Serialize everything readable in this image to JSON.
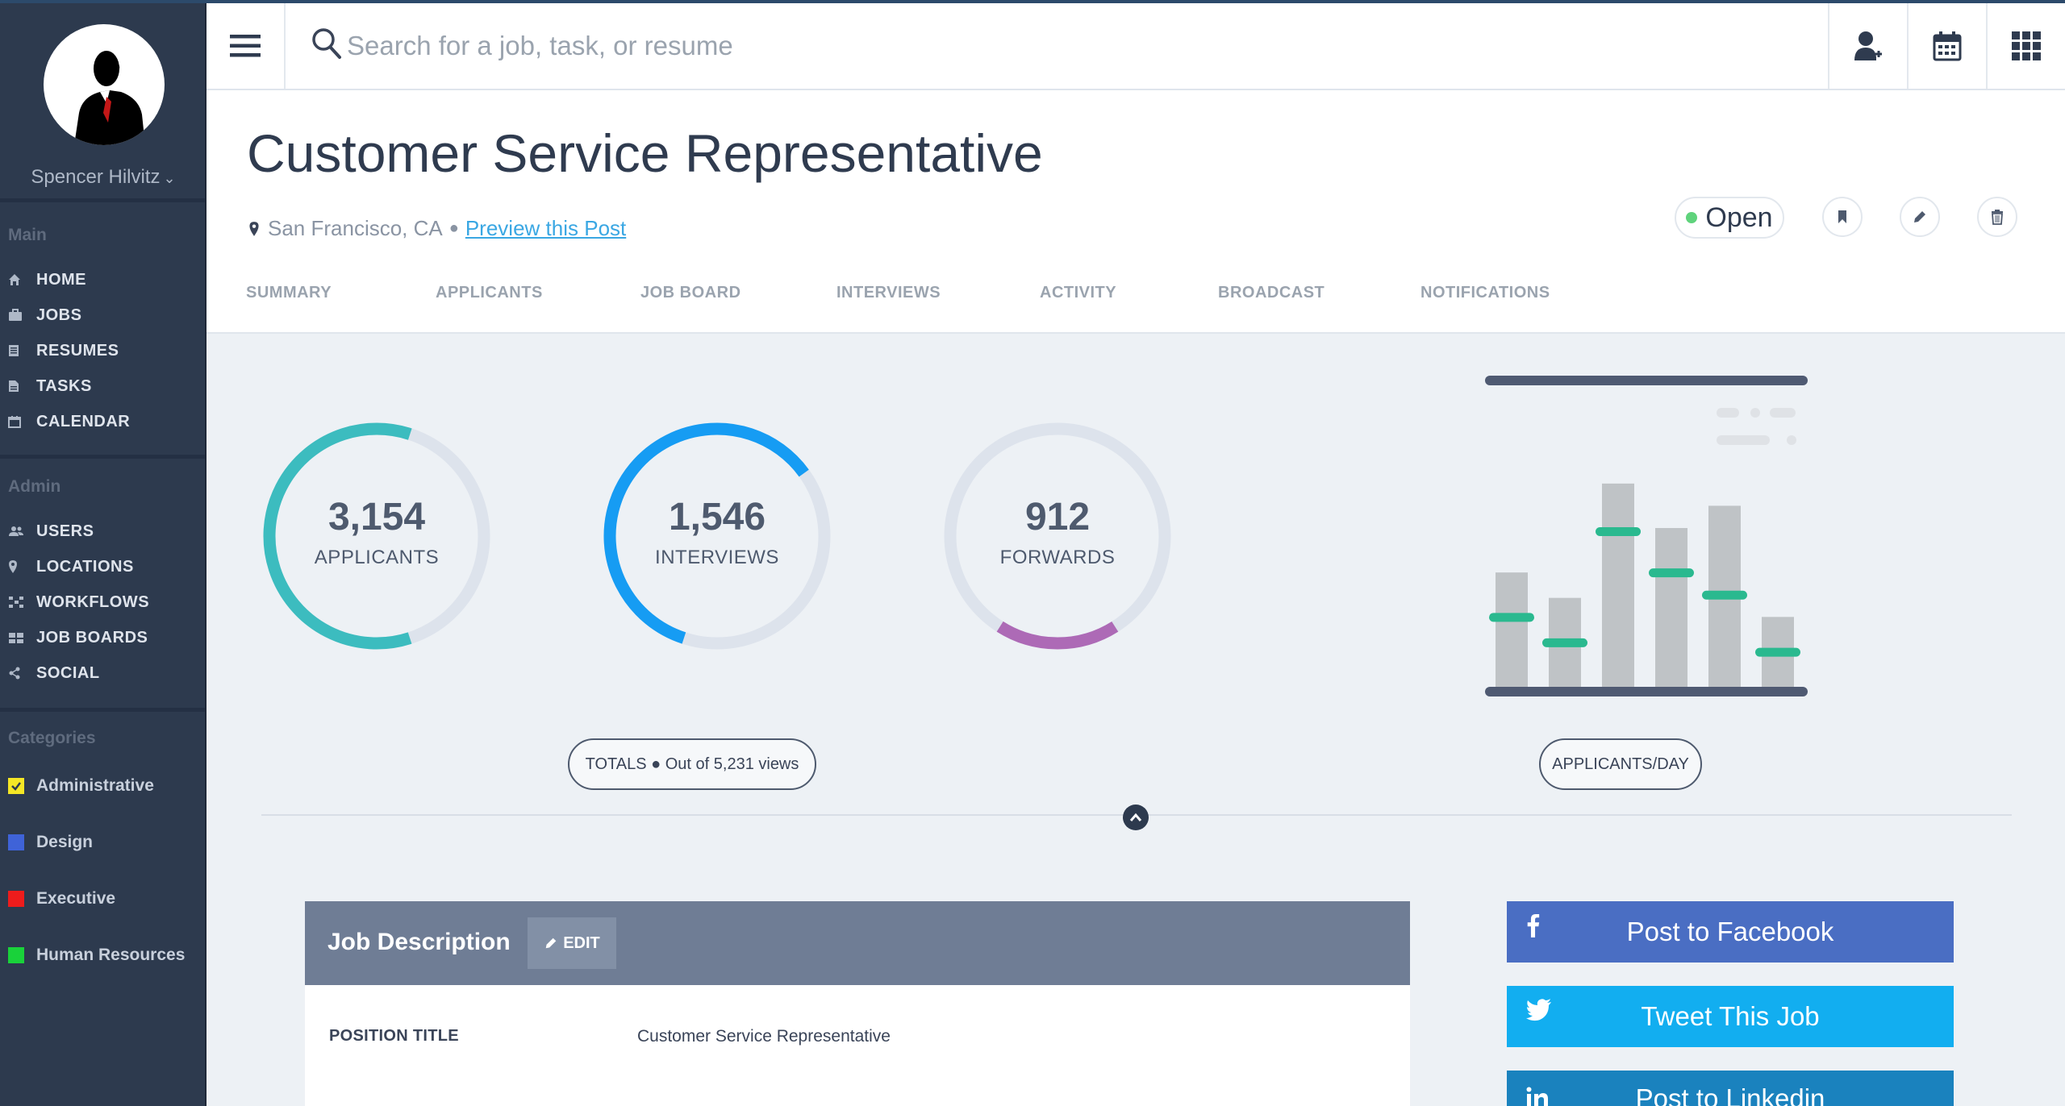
{
  "user": {
    "name": "Spencer Hilvitz",
    "chevron": "chevron-down-icon"
  },
  "sidebar": {
    "sections": {
      "main": "Main",
      "admin": "Admin",
      "categories": "Categories"
    },
    "main_items": [
      {
        "label": "HOME",
        "icon": "home-icon"
      },
      {
        "label": "JOBS",
        "icon": "briefcase-icon"
      },
      {
        "label": "RESUMES",
        "icon": "document-icon"
      },
      {
        "label": "TASKS",
        "icon": "tasks-icon"
      },
      {
        "label": "CALENDAR",
        "icon": "calendar-icon"
      }
    ],
    "admin_items": [
      {
        "label": "USERS",
        "icon": "users-icon"
      },
      {
        "label": "LOCATIONS",
        "icon": "map-pin-icon"
      },
      {
        "label": "WORKFLOWS",
        "icon": "workflow-icon"
      },
      {
        "label": "JOB BOARDS",
        "icon": "job-boards-icon"
      },
      {
        "label": "SOCIAL",
        "icon": "share-icon"
      }
    ],
    "categories": [
      {
        "label": "Administrative",
        "color": "#f5e625",
        "checked": true
      },
      {
        "label": "Design",
        "color": "#3f63d8",
        "checked": false
      },
      {
        "label": "Executive",
        "color": "#ee1c1c",
        "checked": false
      },
      {
        "label": "Human Resources",
        "color": "#19d23a",
        "checked": false
      }
    ]
  },
  "topbar": {
    "search_placeholder": "Search for a job, task, or resume",
    "icons": [
      "add-user-icon",
      "calendar-icon",
      "apps-grid-icon"
    ]
  },
  "job": {
    "title": "Customer Service Representative",
    "location": "San Francisco, CA",
    "separator": "●",
    "preview_link": "Preview this Post",
    "status": "Open",
    "status_color": "#5fd37c"
  },
  "tabs": [
    "SUMMARY",
    "APPLICANTS",
    "JOB BOARD",
    "INTERVIEWS",
    "ACTIVITY",
    "BROADCAST",
    "NOTIFICATIONS"
  ],
  "stats": [
    {
      "value": "3,154",
      "label": "APPLICANTS",
      "fraction": 0.6,
      "color": "#3cbcbf"
    },
    {
      "value": "1,546",
      "label": "INTERVIEWS",
      "fraction": 0.6,
      "color": "#169cf3"
    },
    {
      "value": "912",
      "label": "FORWARDS",
      "fraction": 0.18,
      "color": "#ad6ab6"
    }
  ],
  "totals_pill": "TOTALS ● Out of 5,231 views",
  "chart_pill": "APPLICANTS/DAY",
  "chart_data": {
    "type": "bar",
    "values": [
      0.36,
      0.28,
      0.64,
      0.5,
      0.57,
      0.22
    ],
    "markers": [
      0.22,
      0.14,
      0.49,
      0.36,
      0.29,
      0.11
    ],
    "bar_color": "#bfc3c6",
    "marker_color": "#2ab98f"
  },
  "job_description": {
    "title": "Job Description",
    "edit_label": "EDIT",
    "rows": [
      {
        "key": "POSITION TITLE",
        "value": "Customer Service Representative"
      }
    ]
  },
  "social": [
    {
      "label": "Post to Facebook",
      "icon": "facebook-icon",
      "color": "#4a6ec3"
    },
    {
      "label": "Tweet This Job",
      "icon": "twitter-icon",
      "color": "#12aef0"
    },
    {
      "label": "Post to Linkedin",
      "icon": "linkedin-icon",
      "color": "#1a82be"
    }
  ]
}
